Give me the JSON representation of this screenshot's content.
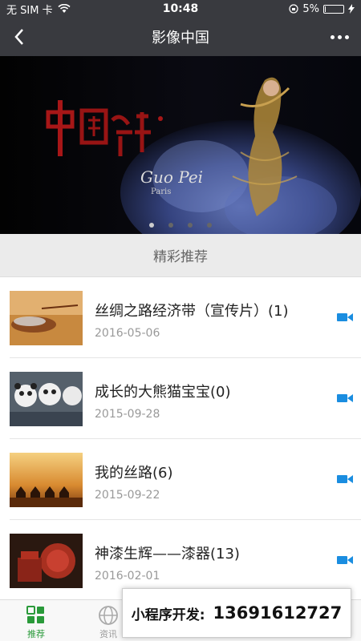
{
  "status": {
    "carrier": "无 SIM 卡",
    "time": "10:48",
    "battery": "5%",
    "battery_level": 0.05
  },
  "nav": {
    "title": "影像中国",
    "back_icon": "chevron-left-icon",
    "more_icon": "more-dots-icon"
  },
  "banner": {
    "title_text": "中国设计",
    "signature_text": "Guo Pei",
    "subtitle_text": "Paris",
    "active_dot": 0,
    "dot_count": 4
  },
  "section": {
    "title": "精彩推荐"
  },
  "items": [
    {
      "title": "丝绸之路经济带（宣传片）(1)",
      "date": "2016-05-06",
      "icon": "video-camera-icon",
      "thumb_color": "#c8893f"
    },
    {
      "title": "成长的大熊猫宝宝(0)",
      "date": "2015-09-28",
      "icon": "video-camera-icon",
      "thumb_color": "#55606b"
    },
    {
      "title": "我的丝路(6)",
      "date": "2015-09-22",
      "icon": "video-camera-icon",
      "thumb_color": "#d08a3a"
    },
    {
      "title": "神漆生辉——漆器(13)",
      "date": "2016-02-01",
      "icon": "video-camera-icon",
      "thumb_color": "#2a1810"
    }
  ],
  "tabs": [
    {
      "label": "推荐",
      "icon": "grid-icon",
      "active": true
    },
    {
      "label": "资讯",
      "icon": "globe-icon",
      "active": false
    }
  ],
  "promo": {
    "label": "小程序开发:",
    "phone": "13691612727"
  },
  "colors": {
    "nav_bg": "#393a3f",
    "accent_green": "#2a9a3a",
    "video_icon_blue": "#1a8de0"
  }
}
